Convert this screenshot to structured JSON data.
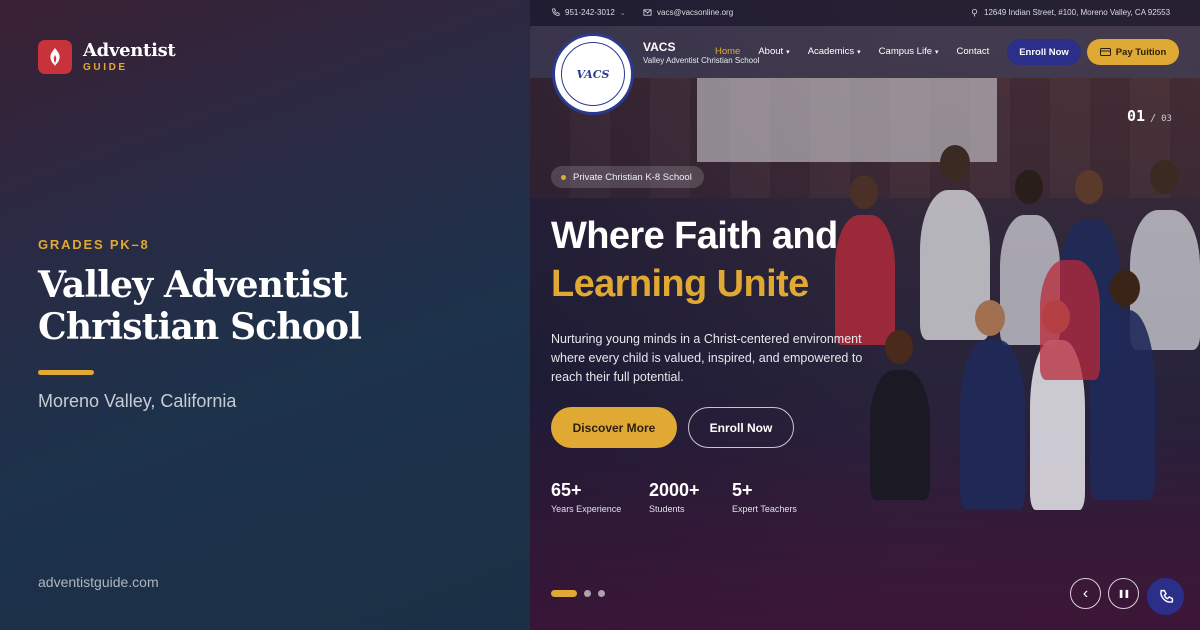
{
  "brand": {
    "name": "Adventist",
    "sub": "GUIDE",
    "logo_color": "#c8323b",
    "accent": "#e0a933"
  },
  "left": {
    "grades": "GRADES PK–8",
    "title_line1": "Valley Adventist",
    "title_line2": "Christian School",
    "location": "Moreno Valley, California",
    "url": "adventistguide.com"
  },
  "topbar": {
    "phone": "951-242-3012",
    "email": "vacs@vacsonline.org",
    "address": "12649 Indian Street, #100, Moreno Valley, CA 92553"
  },
  "nav": {
    "seal_text": "VACS",
    "short_name": "VACS",
    "full_name": "Valley Adventist Christian School",
    "links": [
      {
        "label": "Home"
      },
      {
        "label": "About"
      },
      {
        "label": "Academics"
      },
      {
        "label": "Campus Life"
      },
      {
        "label": "Contact"
      }
    ],
    "enroll_label": "Enroll Now",
    "pay_label": "Pay Tuition"
  },
  "slider": {
    "current": "01",
    "separator": "/",
    "total": "03"
  },
  "hero": {
    "pill": "Private Christian K-8 School",
    "headline_line1": "Where Faith and",
    "headline_line2": "Learning Unite",
    "paragraph": "Nurturing young minds in a Christ-centered environment where every child is valued, inspired, and empowered to reach their full potential.",
    "discover_label": "Discover More",
    "enroll_label": "Enroll Now"
  },
  "stats": [
    {
      "value": "65+",
      "label": "Years Experience"
    },
    {
      "value": "2000+",
      "label": "Students"
    },
    {
      "value": "5+",
      "label": "Expert Teachers"
    }
  ],
  "controls": {
    "prev": "‹",
    "pause": "❚❚"
  }
}
